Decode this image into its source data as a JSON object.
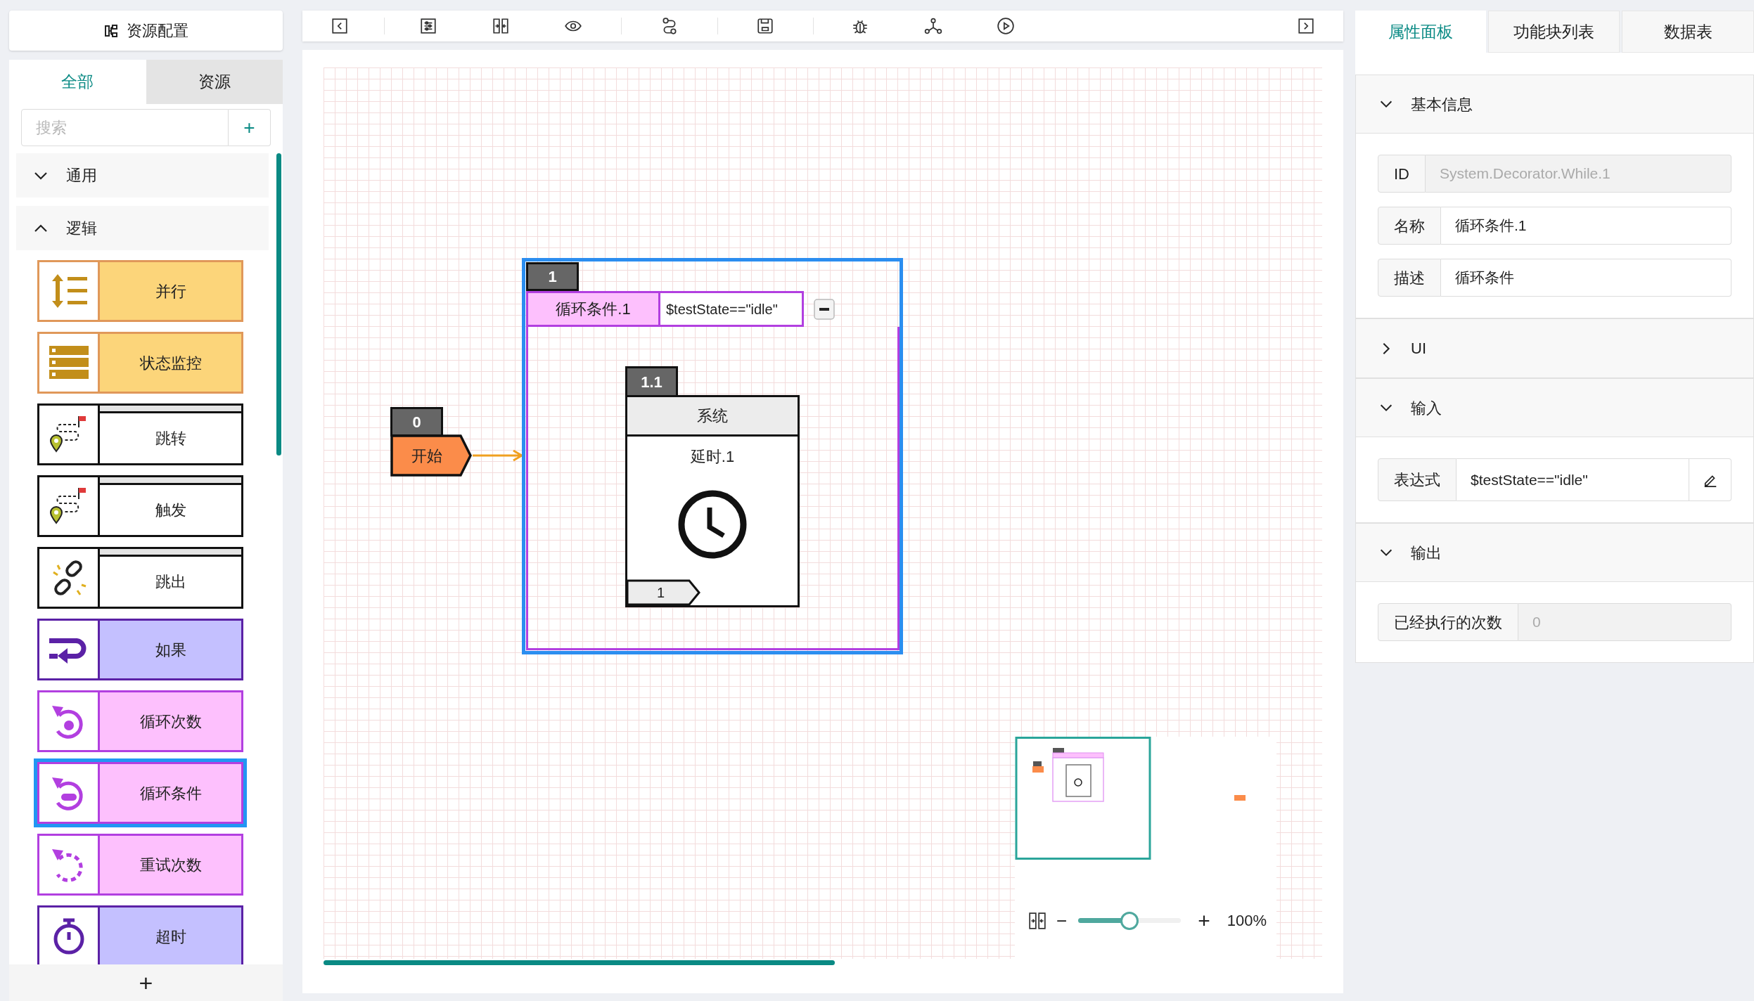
{
  "left_panel": {
    "title": "资源配置",
    "tabs": [
      {
        "label": "全部",
        "selected": true
      },
      {
        "label": "资源",
        "selected": false
      }
    ],
    "search": {
      "placeholder": "搜索",
      "button": "+"
    },
    "groups": [
      {
        "label": "通用",
        "expanded": false
      },
      {
        "label": "逻辑",
        "expanded": true
      }
    ],
    "palette": [
      {
        "label": "并行",
        "kind": "parallel",
        "color": "#fcd57a",
        "selected": false
      },
      {
        "label": "状态监控",
        "kind": "monitor",
        "color": "#fcd57a",
        "selected": false
      },
      {
        "label": "跳转",
        "kind": "jump",
        "color": "#ffffff",
        "selected": false
      },
      {
        "label": "触发",
        "kind": "trigger",
        "color": "#ffffff",
        "selected": false
      },
      {
        "label": "跳出",
        "kind": "break",
        "color": "#ffffff",
        "selected": false
      },
      {
        "label": "如果",
        "kind": "if",
        "color": "#c4c0ff",
        "selected": false
      },
      {
        "label": "循环次数",
        "kind": "repeat",
        "color": "#fdc0fd",
        "selected": false
      },
      {
        "label": "循环条件",
        "kind": "while",
        "color": "#fdc0fd",
        "selected": true
      },
      {
        "label": "重试次数",
        "kind": "retry",
        "color": "#fdc0fd",
        "selected": false
      },
      {
        "label": "超时",
        "kind": "timeout",
        "color": "#c4c0ff",
        "selected": false
      }
    ],
    "add_button": "+"
  },
  "canvas": {
    "start_node": {
      "index": "0",
      "label": "开始"
    },
    "loop_node": {
      "index": "1",
      "name": "循环条件.1",
      "expression": "$testState==\"idle\"",
      "selected": true
    },
    "inner_node": {
      "index": "1.1",
      "category": "系统",
      "name": "延时.1",
      "port": "1"
    },
    "zoom": {
      "level": 0.5,
      "reading": "100%",
      "minus": "−",
      "plus": "+"
    }
  },
  "right_panel": {
    "tabs": [
      {
        "label": "属性面板",
        "selected": true
      },
      {
        "label": "功能块列表",
        "selected": false
      },
      {
        "label": "数据表",
        "selected": false
      }
    ],
    "sections": [
      {
        "title": "基本信息",
        "expanded": true,
        "fields": [
          {
            "label": "ID",
            "value": "System.Decorator.While.1",
            "disabled": true,
            "kind": "text"
          },
          {
            "label": "名称",
            "value": "循环条件.1",
            "disabled": false,
            "kind": "text"
          },
          {
            "label": "描述",
            "value": "循环条件",
            "disabled": false,
            "kind": "text"
          }
        ]
      },
      {
        "title": "UI",
        "expanded": false
      },
      {
        "title": "输入",
        "expanded": true,
        "fields": [
          {
            "label": "表达式",
            "value": "$testState==\"idle\"",
            "disabled": false,
            "kind": "expression"
          }
        ]
      },
      {
        "title": "输出",
        "expanded": true,
        "fields": [
          {
            "label": "已经执行的次数",
            "value": "0",
            "disabled": true,
            "kind": "text"
          }
        ]
      }
    ]
  }
}
